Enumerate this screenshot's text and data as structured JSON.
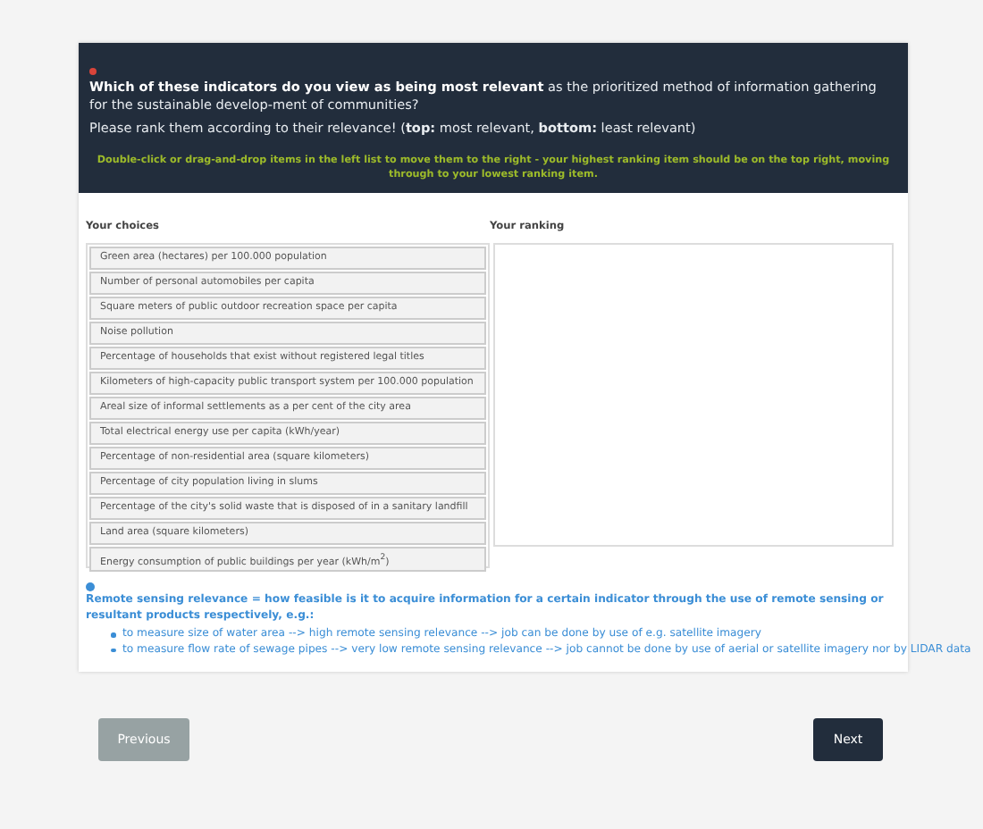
{
  "question": {
    "text": "**Which of these indicators do you view as being most relevant** as the prioritized method of information gathering for the sustainable develop-ment of communities?",
    "instruction": "Please rank them according to their relevance! (**top:** most relevant, **bottom:** least relevant)",
    "hint": "Double-click or drag-and-drop items in the left list to move them to the right - your highest ranking item should be on the top right, moving through to your lowest ranking item."
  },
  "choices": {
    "label": "Your choices",
    "items": [
      "Green area (hectares) per 100.000 population",
      "Number of personal automobiles per capita",
      "Square meters of public outdoor recreation space per capita",
      "Noise pollution",
      "Percentage of households that exist without registered legal titles",
      "Kilometers of high-capacity public transport system per 100.000 population",
      "Areal size of informal settlements as a per cent of the city area",
      "Total electrical energy use per capita (kWh/year)",
      "Percentage of non-residential area (square kilometers)",
      "Percentage of city population living in slums",
      "Percentage of the city's solid waste that is disposed of in a sanitary landfill",
      "Land area (square kilometers)",
      "Energy consumption of public buildings per year (kWh/m$^{2}$)"
    ]
  },
  "ranking": {
    "label": "Your ranking"
  },
  "note": {
    "text": "Remote sensing relevance = how feasible is it to acquire information for a certain indicator through the use of remote sensing or resultant products respectively, e.g.:",
    "examples": [
      "to measure size of water area --> high remote sensing relevance --> job can be done by use of e.g. satellite imagery",
      "to measure flow rate of sewage pipes --> very low remote sensing relevance --> job cannot be done by use of aerial or satellite imagery nor by LIDAR data"
    ]
  },
  "buttons": [
    {
      "label": "Previous",
      "kind": "secondary"
    },
    {
      "label": "Next",
      "kind": "primary"
    }
  ]
}
